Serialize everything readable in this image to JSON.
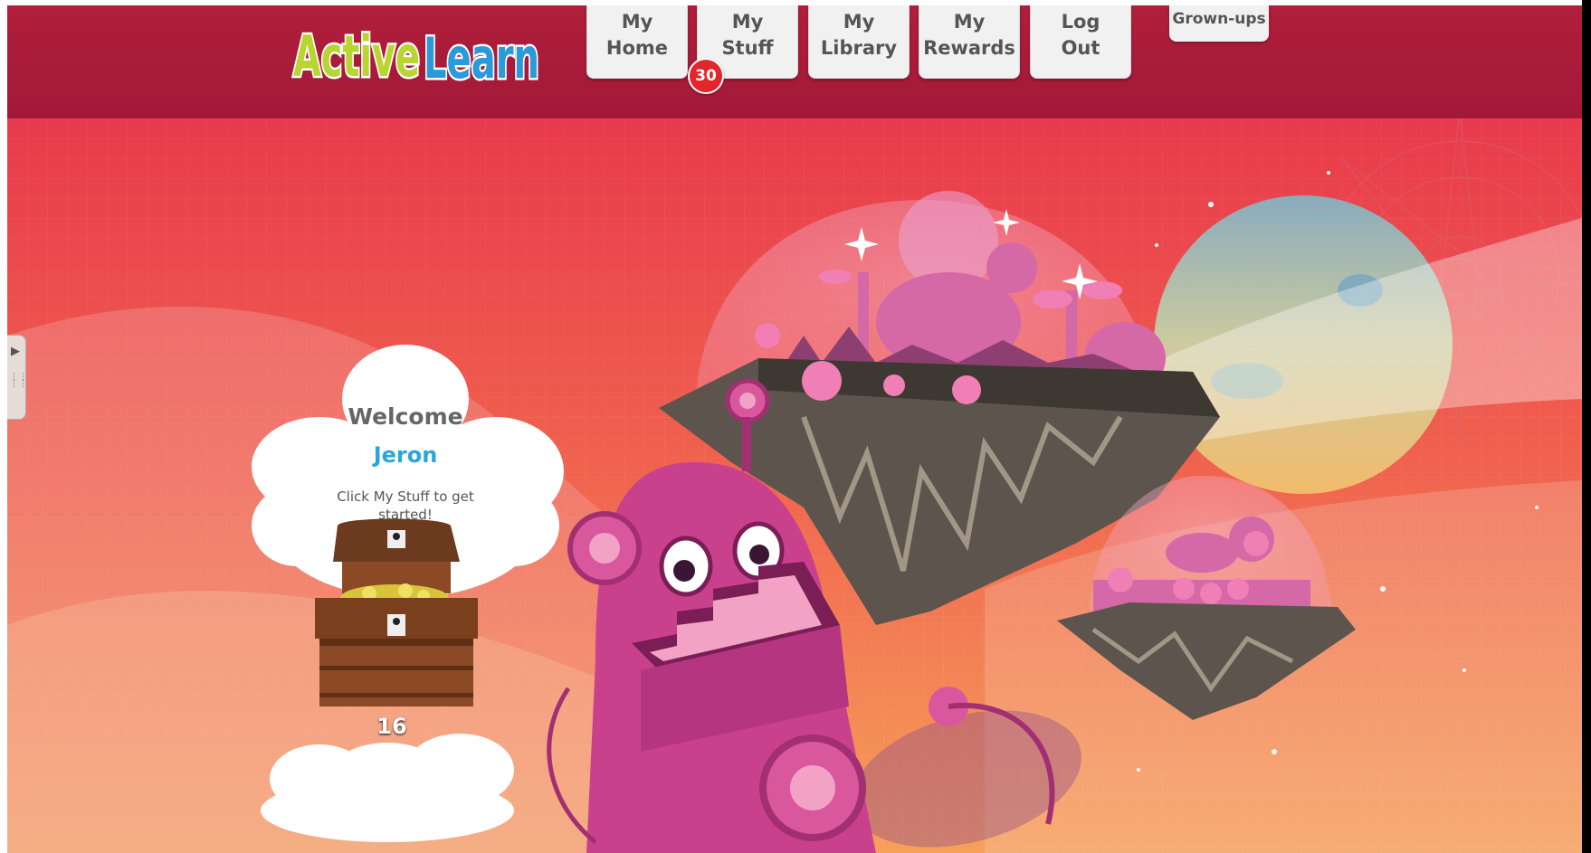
{
  "header": {
    "logo_text": "ActiveLearn",
    "nav": [
      {
        "line1": "My",
        "line2": "Home"
      },
      {
        "line1": "My",
        "line2": "Stuff"
      },
      {
        "line1": "My",
        "line2": "Library"
      },
      {
        "line1": "My",
        "line2": "Rewards"
      },
      {
        "line1": "Log",
        "line2": "Out"
      }
    ],
    "grownups_label": "Grown-ups",
    "mystuff_badge": "30"
  },
  "welcome": {
    "title": "Welcome",
    "name": "Jeron",
    "hint": "Click My Stuff to get started!"
  },
  "rewards": {
    "coin_count": "16"
  },
  "colors": {
    "header_bg": "#a81b3b",
    "name_blue": "#2aa6d8",
    "badge_red": "#e3262b",
    "robot_pink": "#c9418d"
  }
}
